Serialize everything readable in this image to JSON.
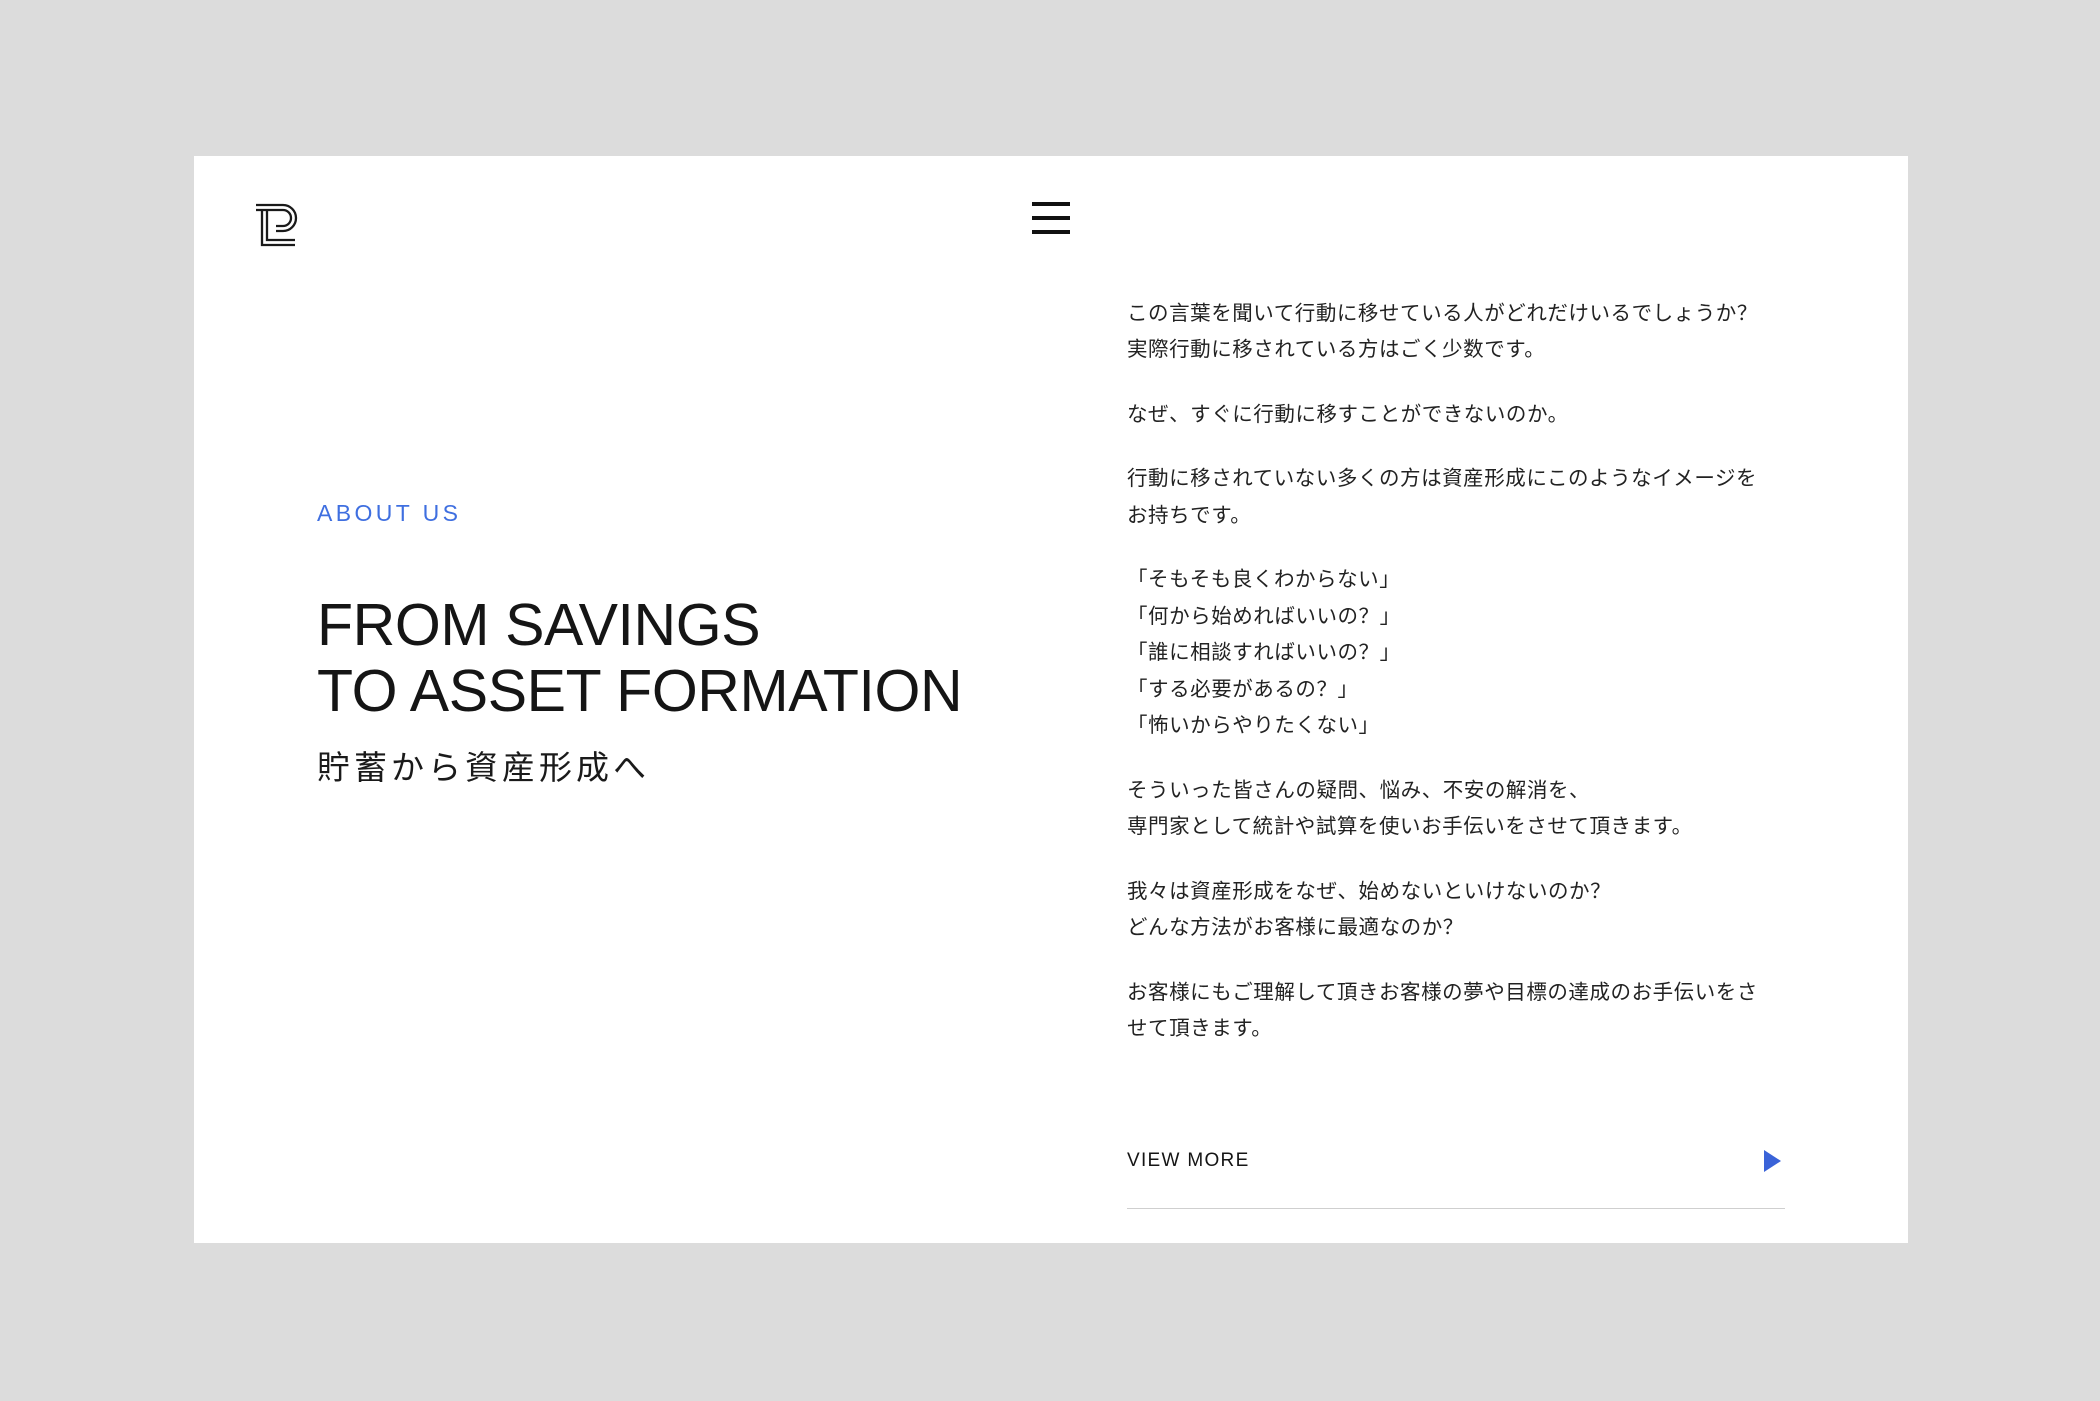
{
  "theme": {
    "page_background": "#dcdcdc",
    "card_background": "#ffffff",
    "accent_blue": "#3f6fe0",
    "arrow_blue": "#3a63d8",
    "text_color": "#151515",
    "rule_color": "#cfcfcf"
  },
  "header": {
    "logo_name": "lp-monogram-logo",
    "menu_name": "hamburger-menu-icon"
  },
  "about": {
    "eyebrow": "ABOUT US",
    "headline": "FROM SAVINGS\nTO ASSET FORMATION",
    "subheadline": "貯蓄から資産形成へ"
  },
  "body": {
    "paragraphs": [
      "この言葉を聞いて行動に移せている人がどれだけいるでしょうか？\n実際行動に移されている方はごく少数です。",
      "なぜ、すぐに行動に移すことができないのか。",
      "行動に移されていない多くの方は資産形成にこのようなイメージを\nお持ちです。",
      "「そもそも良くわからない」\n「何から始めればいいの？」\n「誰に相談すればいいの？」\n「する必要があるの？」\n「怖いからやりたくない」",
      "そういった皆さんの疑問、悩み、不安の解消を、\n専門家として統計や試算を使いお手伝いをさせて頂きます。",
      "我々は資産形成をなぜ、始めないといけないのか？\nどんな方法がお客様に最適なのか？",
      "お客様にもご理解して頂きお客様の夢や目標の達成のお手伝いをさ\nせて頂きます。"
    ]
  },
  "view_more": {
    "label": "VIEW MORE",
    "arrow_name": "play-triangle-icon"
  }
}
